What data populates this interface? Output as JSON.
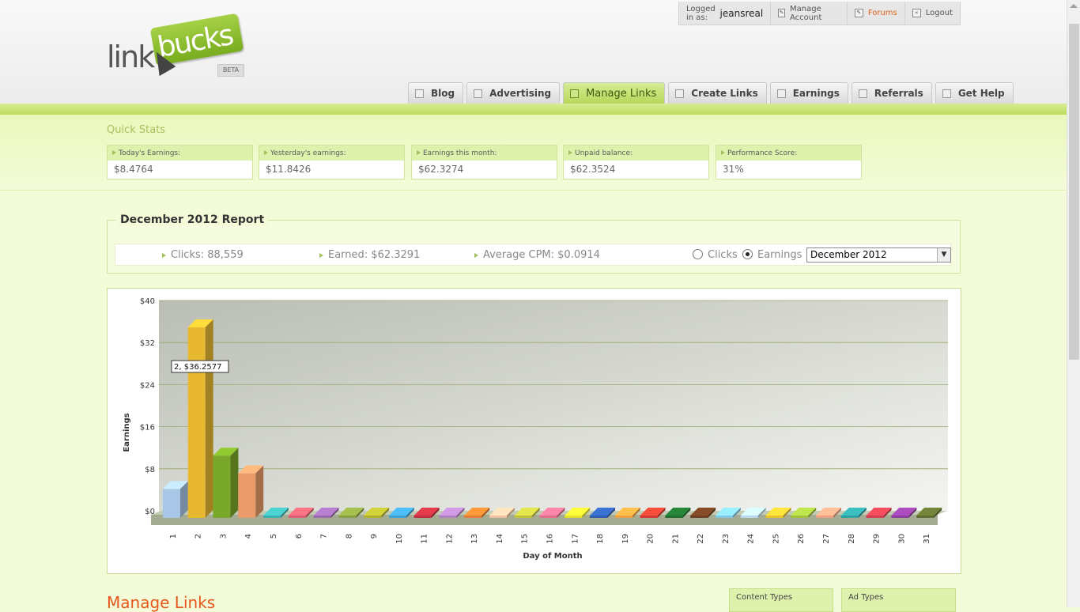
{
  "logo": {
    "text_left": "link",
    "text_right": "bucks",
    "badge": "BETA"
  },
  "account": {
    "logged_in_label": "Logged in as:",
    "username": "jeansreal",
    "manage_account": "Manage Account",
    "forums": "Forums",
    "logout": "Logout"
  },
  "nav": {
    "tabs": [
      {
        "label": "Blog",
        "active": false
      },
      {
        "label": "Advertising",
        "active": false
      },
      {
        "label": "Manage Links",
        "active": true
      },
      {
        "label": "Create Links",
        "active": false
      },
      {
        "label": "Earnings",
        "active": false
      },
      {
        "label": "Referrals",
        "active": false
      },
      {
        "label": "Get Help",
        "active": false
      }
    ]
  },
  "quick_stats": {
    "title": "Quick Stats",
    "items": [
      {
        "label": "Today's Earnings:",
        "value": "$8.4764"
      },
      {
        "label": "Yesterday's earnings:",
        "value": "$11.8426"
      },
      {
        "label": "Earnings this month:",
        "value": "$62.3274"
      },
      {
        "label": "Unpaid balance:",
        "value": "$62.3524"
      },
      {
        "label": "Performance Score:",
        "value": "31%"
      }
    ]
  },
  "report": {
    "title": "December 2012 Report",
    "clicks": "Clicks: 88,559",
    "earned": "Earned: $62.3291",
    "avg_cpm": "Average CPM: $0.0914",
    "radio_clicks": "Clicks",
    "radio_earnings": "Earnings",
    "selected_metric": "Earnings",
    "month_selected": "December 2012"
  },
  "chart_data": {
    "type": "bar",
    "x": [
      1,
      2,
      3,
      4,
      5,
      6,
      7,
      8,
      9,
      10,
      11,
      12,
      13,
      14,
      15,
      16,
      17,
      18,
      19,
      20,
      21,
      22,
      23,
      24,
      25,
      26,
      27,
      28,
      29,
      30,
      31
    ],
    "values": [
      5.5,
      36.2577,
      11.85,
      8.48,
      0,
      0,
      0,
      0,
      0,
      0,
      0,
      0,
      0,
      0,
      0,
      0,
      0,
      0,
      0,
      0,
      0,
      0,
      0,
      0,
      0,
      0,
      0,
      0,
      0,
      0,
      0
    ],
    "y_ticks": [
      "$0",
      "$8",
      "$16",
      "$24",
      "$32",
      "$40"
    ],
    "ylim": [
      0,
      40
    ],
    "xlabel": "Day of Month",
    "ylabel": "Earnings",
    "tooltip": "2, $36.2577",
    "grid": true,
    "colors": [
      "#a8c6e6",
      "#e8b830",
      "#7aa82a",
      "#e99b6a",
      "#3fb0b0",
      "#d86070",
      "#9a6ab0",
      "#8aa040",
      "#b0b030",
      "#40a0d0",
      "#c03040",
      "#b080c0",
      "#e08030",
      "#f0c0a0",
      "#c0c040",
      "#e07090",
      "#e8e030",
      "#3060b0",
      "#f0a040",
      "#d04030",
      "#207030",
      "#704020",
      "#80c8e8",
      "#b8d8f0",
      "#e8c030",
      "#a0c040",
      "#f0a080",
      "#30a0a0",
      "#d04050",
      "#9040a0",
      "#607030"
    ]
  },
  "manage_links": {
    "title": "Manage Links",
    "content_types": "Content Types",
    "ad_types": "Ad Types"
  }
}
